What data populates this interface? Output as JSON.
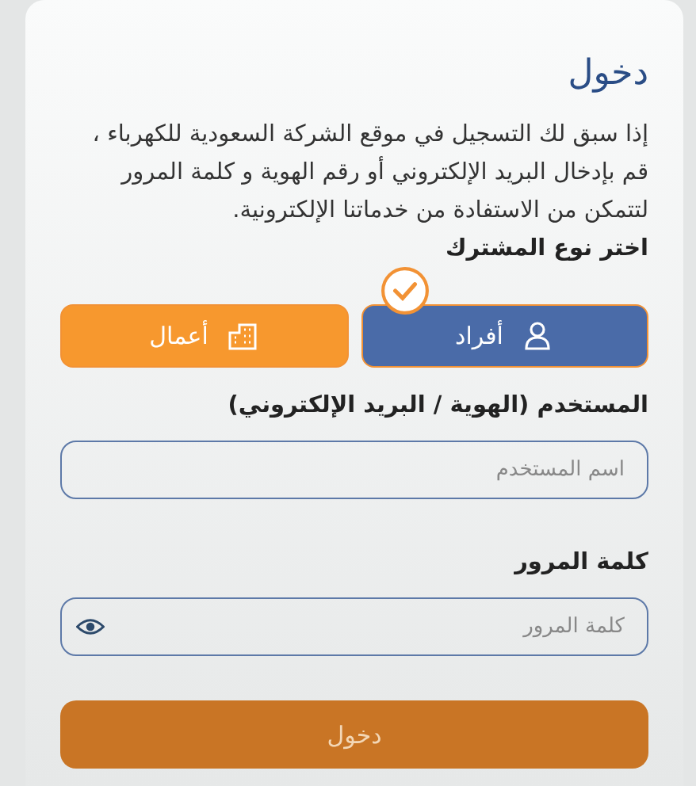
{
  "title": "دخول",
  "intro": "إذا سبق لك التسجيل في موقع الشركة السعودية للكهرباء ، قم بإدخال البريد الإلكتروني أو رقم الهوية و كلمة المرور لتتمكن من الاستفادة من خدماتنا الإلكترونية.",
  "subscriber_type": {
    "label": "اختر نوع المشترك",
    "options": [
      {
        "label": "أفراد",
        "kind": "individual",
        "selected": true
      },
      {
        "label": "أعمال",
        "kind": "business",
        "selected": false
      }
    ]
  },
  "fields": [
    {
      "kind": "text",
      "label": "المستخدم (الهوية / البريد الإلكتروني)",
      "placeholder": "اسم المستخدم"
    },
    {
      "kind": "password",
      "label": "كلمة المرور",
      "placeholder": "كلمة المرور"
    }
  ],
  "submit": "دخول"
}
